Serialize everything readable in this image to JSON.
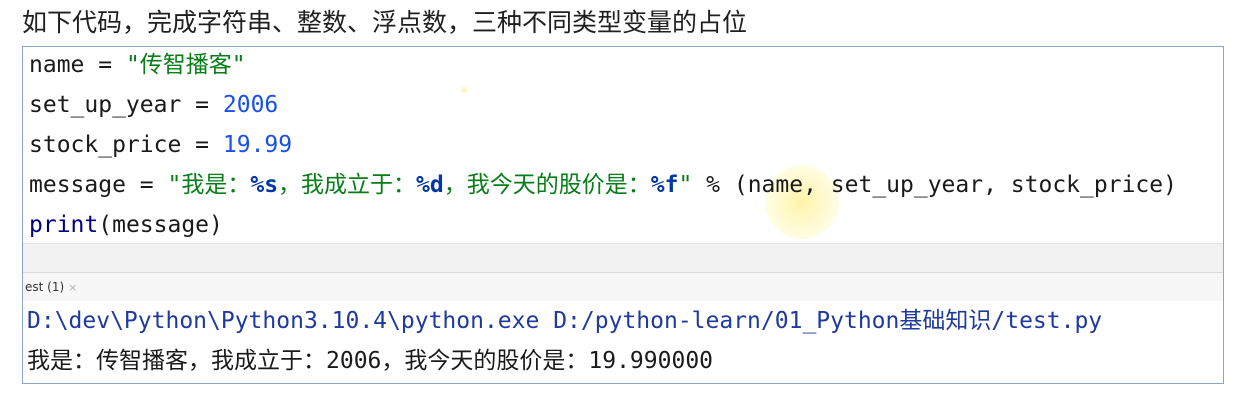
{
  "heading": "如下代码，完成字符串、整数、浮点数，三种不同类型变量的占位",
  "code": {
    "line1": {
      "var": "name",
      "op": " = ",
      "str": "\"传智播客\""
    },
    "line2": {
      "var": "set_up_year",
      "op": " = ",
      "num": "2006"
    },
    "line3": {
      "var": "stock_price",
      "op": " = ",
      "num": "19.99"
    },
    "line4": {
      "var": "message",
      "op": " = ",
      "q1": "\"",
      "t1": "我是：",
      "f1": "%s",
      "t2": "，我成立于：",
      "f2": "%d",
      "t3": "，我今天的股价是：",
      "f3": "%f",
      "q2": "\"",
      "rest": " % (name, set_up_year, stock_price)"
    },
    "line5": {
      "fn": "print",
      "args": "(message)"
    }
  },
  "run_tab": {
    "label": "est (1)",
    "close": "×"
  },
  "console": {
    "command": "D:\\dev\\Python\\Python3.10.4\\python.exe D:/python-learn/01_Python基础知识/test.py",
    "output": "我是：传智播客，我成立于：2006，我今天的股价是：19.990000"
  },
  "colors": {
    "string": "#067d17",
    "number": "#1750eb",
    "format_spec": "#0037a6",
    "console_command": "#1f3a9e",
    "frame_border": "#8aa7c8"
  }
}
